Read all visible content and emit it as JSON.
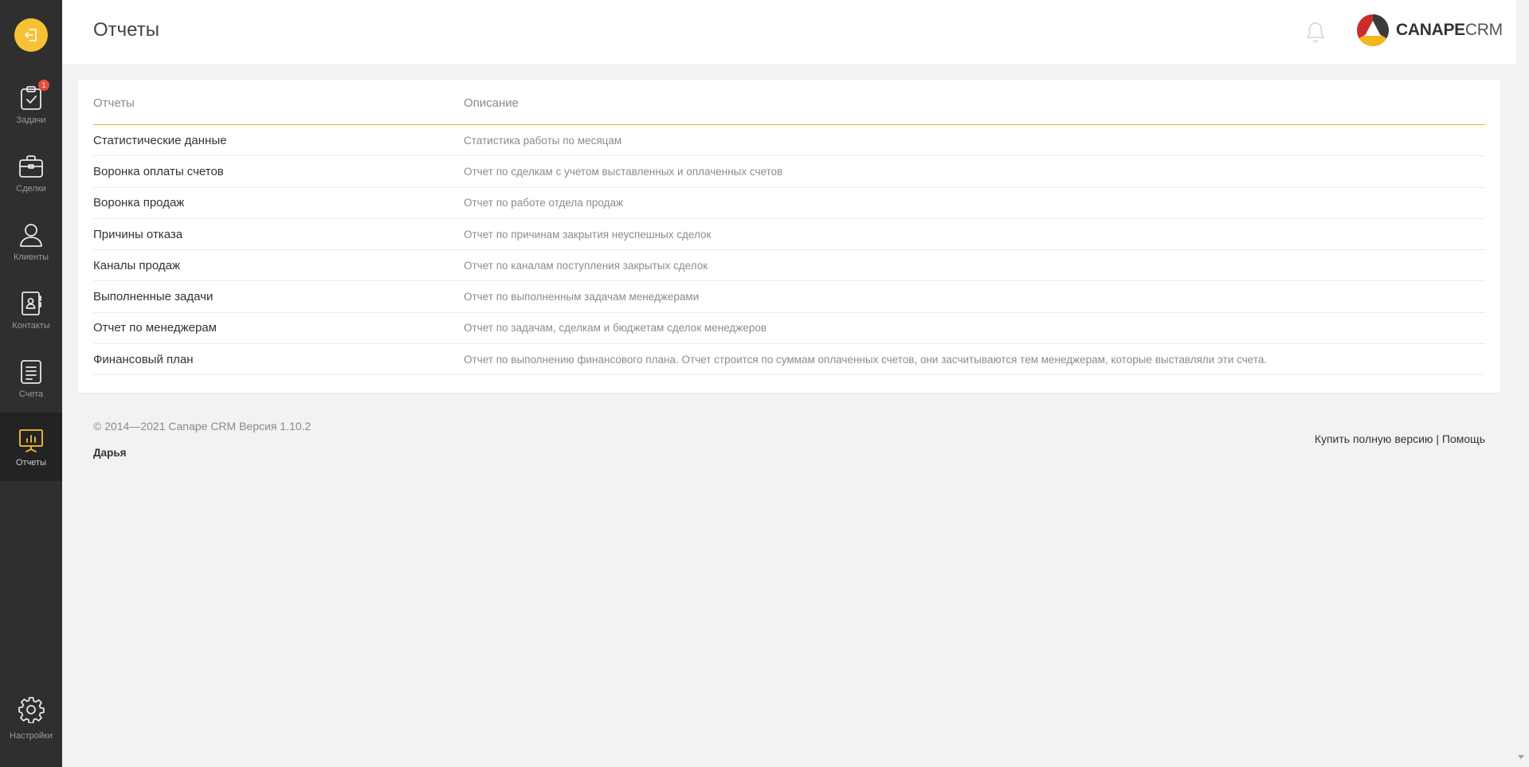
{
  "header": {
    "title": "Отчеты",
    "logo_bold": "CANAPE",
    "logo_light": "CRM"
  },
  "sidebar": {
    "items": [
      {
        "label": "Задачи",
        "icon": "clipboard-check-icon",
        "badge": "1"
      },
      {
        "label": "Сделки",
        "icon": "briefcase-icon"
      },
      {
        "label": "Клиенты",
        "icon": "user-icon"
      },
      {
        "label": "Контакты",
        "icon": "contact-book-icon"
      },
      {
        "label": "Счета",
        "icon": "document-icon"
      },
      {
        "label": "Отчеты",
        "icon": "chart-board-icon",
        "active": true
      }
    ],
    "settings_label": "Настройки"
  },
  "reports": {
    "col_report": "Отчеты",
    "col_description": "Описание",
    "rows": [
      {
        "name": "Статистические данные",
        "description": "Статистика работы по месяцам"
      },
      {
        "name": "Воронка оплаты счетов",
        "description": "Отчет по сделкам с учетом выставленных и оплаченных счетов"
      },
      {
        "name": "Воронка продаж",
        "description": "Отчет по работе отдела продаж"
      },
      {
        "name": "Причины отказа",
        "description": "Отчет по причинам закрытия неуспешных сделок"
      },
      {
        "name": "Каналы продаж",
        "description": "Отчет по каналам поступления закрытых сделок"
      },
      {
        "name": "Выполненные задачи",
        "description": "Отчет по выполненным задачам менеджерами"
      },
      {
        "name": "Отчет по менеджерам",
        "description": "Отчет по задачам, сделкам и бюджетам сделок менеджеров"
      },
      {
        "name": "Финансовый план",
        "description": "Отчет по выполнению финансового плана. Отчет строится по суммам оплаченных счетов, они засчитываются тем менеджерам, которые выставляли эти счета."
      }
    ]
  },
  "footer": {
    "copyright": "© 2014—2021 Canape CRM Версия 1.10.2",
    "user": "Дарья",
    "buy_link": "Купить полную версию",
    "separator": "|",
    "help_link": "Помощь"
  },
  "colors": {
    "accent": "#f6c234",
    "sidebar_bg": "#2f2f2f",
    "badge": "#e74c3c"
  }
}
